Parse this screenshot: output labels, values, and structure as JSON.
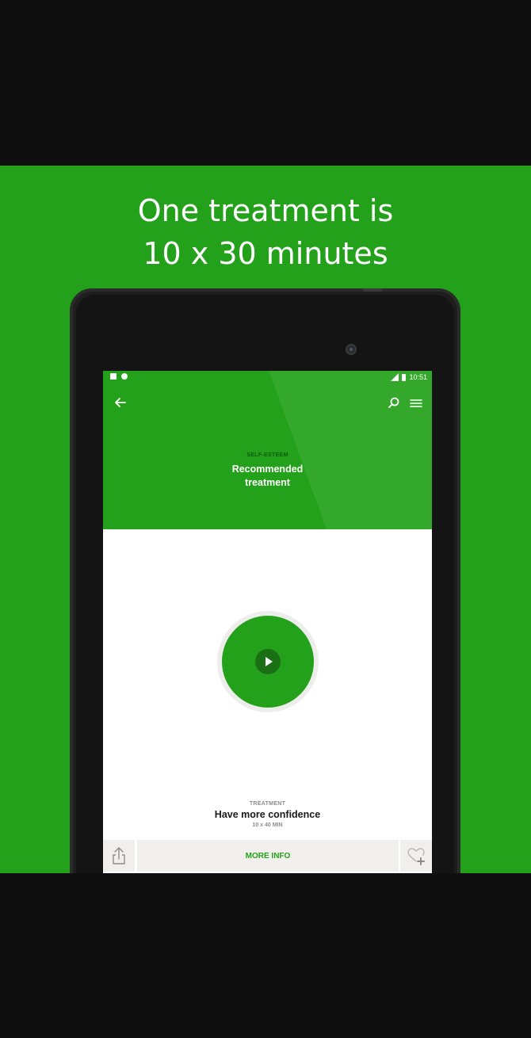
{
  "promo": {
    "headline_line1": "One treatment is",
    "headline_line2": "10 x 30 minutes",
    "background_color": "#23a11a"
  },
  "status_bar": {
    "left_icons": [
      "notification-a-icon",
      "sync-circle-icon"
    ],
    "right_icons": [
      "signal-icon",
      "battery-icon"
    ],
    "time": "10:51"
  },
  "toolbar": {
    "back_icon": "arrow-left-icon",
    "search_icon": "search-icon",
    "menu_icon": "hamburger-menu-icon"
  },
  "header": {
    "category": "SELF-ESTEEM",
    "title": "Recommended treatment"
  },
  "player": {
    "play_icon": "play-icon"
  },
  "treatment": {
    "label": "TREATMENT",
    "title": "Have more confidence",
    "duration": "10 x 40 MIN"
  },
  "bottom_bar": {
    "share_icon": "share-icon",
    "more_info_label": "MORE INFO",
    "favorite_icon": "heart-plus-icon"
  },
  "colors": {
    "accent": "#23a11a",
    "accent_dark": "#1a6e14",
    "bar_bg": "#f0efeb"
  }
}
